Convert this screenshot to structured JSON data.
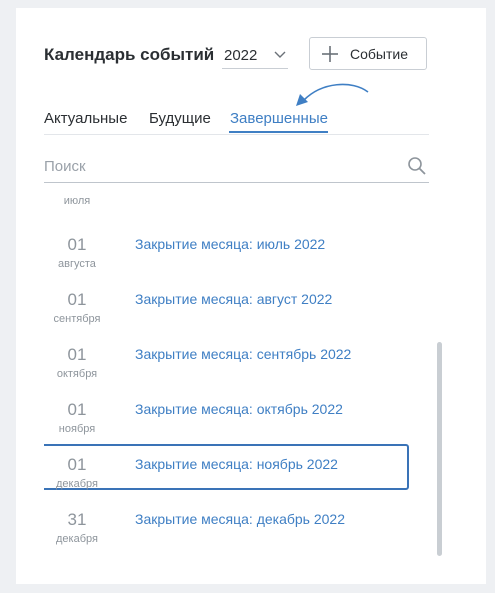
{
  "header": {
    "title": "Календарь событий",
    "year": "2022",
    "add_button_label": "Событие"
  },
  "tabs": [
    {
      "label": "Актуальные",
      "active": false
    },
    {
      "label": "Будущие",
      "active": false
    },
    {
      "label": "Завершенные",
      "active": true
    }
  ],
  "search": {
    "placeholder": "Поиск",
    "value": ""
  },
  "list": {
    "partial_month": "июля",
    "items": [
      {
        "day": "01",
        "month": "августа",
        "title": "Закрытие месяца: июль 2022"
      },
      {
        "day": "01",
        "month": "сентября",
        "title": "Закрытие месяца: август 2022"
      },
      {
        "day": "01",
        "month": "октября",
        "title": "Закрытие месяца: сентябрь 2022"
      },
      {
        "day": "01",
        "month": "ноября",
        "title": "Закрытие месяца: октябрь 2022"
      },
      {
        "day": "01",
        "month": "декабря",
        "title": "Закрытие месяца: ноябрь 2022",
        "selected": true
      },
      {
        "day": "31",
        "month": "декабря",
        "title": "Закрытие месяца: декабрь 2022"
      }
    ]
  },
  "colors": {
    "accent": "#3f7fc4",
    "selection_border": "#3a73b7",
    "muted_text": "#8e959c"
  },
  "icons": {
    "year_dropdown": "chevron-down-icon",
    "add": "plus-icon",
    "search": "search-icon",
    "annotation": "curved-arrow-icon"
  }
}
